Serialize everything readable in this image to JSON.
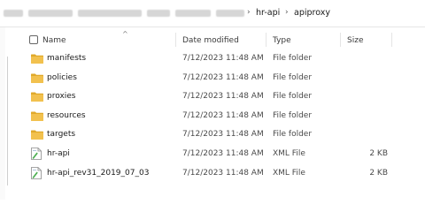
{
  "breadcrumb": {
    "separator": "›",
    "items": [
      {
        "label": "hr-api"
      },
      {
        "label": "apiproxy"
      }
    ]
  },
  "header": {
    "name": "Name",
    "date_modified": "Date modified",
    "type": "Type",
    "size": "Size",
    "sort_indicator": "^"
  },
  "files": [
    {
      "name": "manifests",
      "date": "7/12/2023 11:48 AM",
      "type": "File folder",
      "size": "",
      "icon": "folder-icon"
    },
    {
      "name": "policies",
      "date": "7/12/2023 11:48 AM",
      "type": "File folder",
      "size": "",
      "icon": "folder-icon"
    },
    {
      "name": "proxies",
      "date": "7/12/2023 11:48 AM",
      "type": "File folder",
      "size": "",
      "icon": "folder-icon"
    },
    {
      "name": "resources",
      "date": "7/12/2023 11:48 AM",
      "type": "File folder",
      "size": "",
      "icon": "folder-icon"
    },
    {
      "name": "targets",
      "date": "7/12/2023 11:48 AM",
      "type": "File folder",
      "size": "",
      "icon": "folder-icon"
    },
    {
      "name": "hr-api",
      "date": "7/12/2023 11:48 AM",
      "type": "XML File",
      "size": "2 KB",
      "icon": "xml-file-icon"
    },
    {
      "name": "hr-api_rev31_2019_07_03",
      "date": "7/12/2023 11:48 AM",
      "type": "XML File",
      "size": "2 KB",
      "icon": "xml-file-icon"
    }
  ],
  "colors": {
    "folder": "#f2c14e",
    "folder_dark": "#e0a92a",
    "xml_green": "#4caf50"
  }
}
